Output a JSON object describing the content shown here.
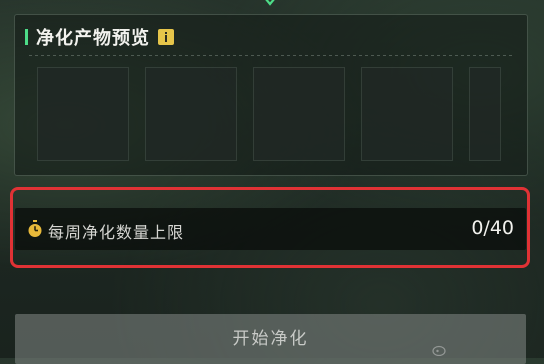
{
  "panel": {
    "title": "净化产物预览",
    "info_icon": "info-icon",
    "slot_count": 5
  },
  "weekly_limit": {
    "icon": "stopwatch-icon",
    "label": "每周净化数量上限",
    "value": "0/40"
  },
  "start_button": {
    "label": "开始净化"
  },
  "colors": {
    "accent_green": "#4ddc88",
    "info_yellow": "#e6c54a",
    "highlight_red": "#e03235",
    "stopwatch_yellow": "#e8b93a"
  }
}
